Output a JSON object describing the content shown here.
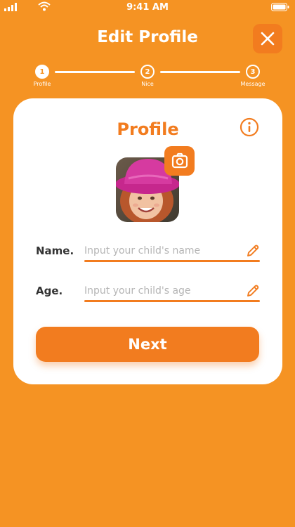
{
  "status_bar": {
    "time": "9:41 AM"
  },
  "header": {
    "title": "Edit Profile"
  },
  "stepper": {
    "steps": [
      {
        "number": "1",
        "label": "Profile"
      },
      {
        "number": "2",
        "label": "Nice"
      },
      {
        "number": "3",
        "label": "Message"
      }
    ]
  },
  "card": {
    "title": "Profile",
    "fields": [
      {
        "label": "Name.",
        "placeholder": "Input your child's name",
        "value": ""
      },
      {
        "label": "Age.",
        "placeholder": "Input your child's age",
        "value": ""
      }
    ],
    "next_label": "Next"
  },
  "colors": {
    "background": "#F59323",
    "accent": "#F27C1F",
    "card": "#FFFFFF",
    "placeholder": "#B5B5B5"
  },
  "icons": [
    "signal-icon",
    "wifi-icon",
    "battery-icon",
    "close-icon",
    "info-icon",
    "camera-icon",
    "pencil-icon"
  ]
}
